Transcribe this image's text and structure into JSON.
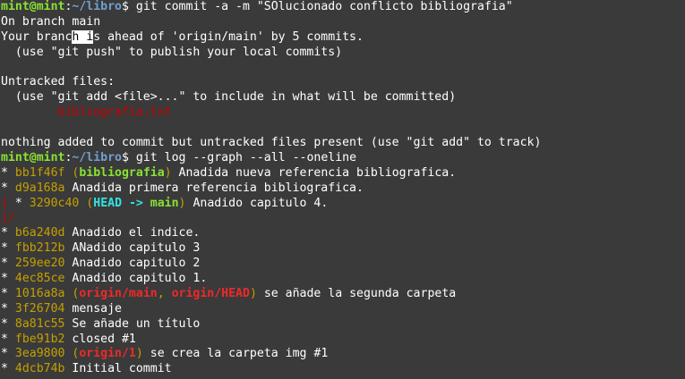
{
  "prompt": {
    "user": "mint@mint",
    "sep": ":",
    "path": "~/libro",
    "symbol": "$"
  },
  "commands": {
    "commit": " git commit -a -m \"SOlucionado conflicto bibliografia\"",
    "log": " git log --graph --all --oneline"
  },
  "status": {
    "branch": "On branch main",
    "ahead_pre": "Your branc",
    "ahead_cursor": "h i",
    "ahead_post": "s ahead of 'origin/main' by 5 commits.",
    "push_hint": "  (use \"git push\" to publish your local commits)",
    "untracked_header": "Untracked files:",
    "add_hint": "  (use \"git add <file>...\" to include in what will be committed)",
    "untracked_file": "bibliografia.txt",
    "nothing_added": "nothing added to commit but untracked files present (use \"git add\" to track)"
  },
  "log": {
    "c1": {
      "graph": "* ",
      "hash": "bb1f46f",
      "ref_open": " (",
      "ref": "bibliografia",
      "ref_close": ")",
      "msg": " Anadida nueva referencia bibliografica."
    },
    "c2": {
      "graph": "* ",
      "hash": "d9a168a",
      "msg": " Anadida primera referencia bibliografica."
    },
    "c3": {
      "graph_pipe": "|",
      "graph": " * ",
      "hash": "3290c40",
      "ref_open": " (",
      "head": "HEAD -> ",
      "ref": "main",
      "ref_close": ")",
      "msg": " Anadido capitulo 4."
    },
    "merge": {
      "graph": "|/"
    },
    "c4": {
      "graph": "* ",
      "hash": "b6a240d",
      "msg": " Anadido el indice."
    },
    "c5": {
      "graph": "* ",
      "hash": "fbb212b",
      "msg": " ANadido capitulo 3"
    },
    "c6": {
      "graph": "* ",
      "hash": "259ee20",
      "msg": " Anadido capitulo 2"
    },
    "c7": {
      "graph": "* ",
      "hash": "4ec85ce",
      "msg": " Anadido capitulo 1."
    },
    "c8": {
      "graph": "* ",
      "hash": "1016a8a",
      "ref_open": " (",
      "ref1": "origin/main",
      "ref_sep": ", ",
      "ref2": "origin/HEAD",
      "ref_close": ")",
      "msg": " se añade la segunda carpeta"
    },
    "c9": {
      "graph": "* ",
      "hash": "3f26704",
      "msg": " mensaje"
    },
    "c10": {
      "graph": "* ",
      "hash": "8a81c55",
      "msg": " Se añade un título"
    },
    "c11": {
      "graph": "* ",
      "hash": "fbe91b2",
      "msg": " closed #1"
    },
    "c12": {
      "graph": "* ",
      "hash": "3ea9800",
      "ref_open": " (",
      "ref": "origin/1",
      "ref_close": ")",
      "msg": " se crea la carpeta img #1"
    },
    "c13": {
      "graph": "* ",
      "hash": "4dcb74b",
      "msg": " Initial commit"
    }
  }
}
